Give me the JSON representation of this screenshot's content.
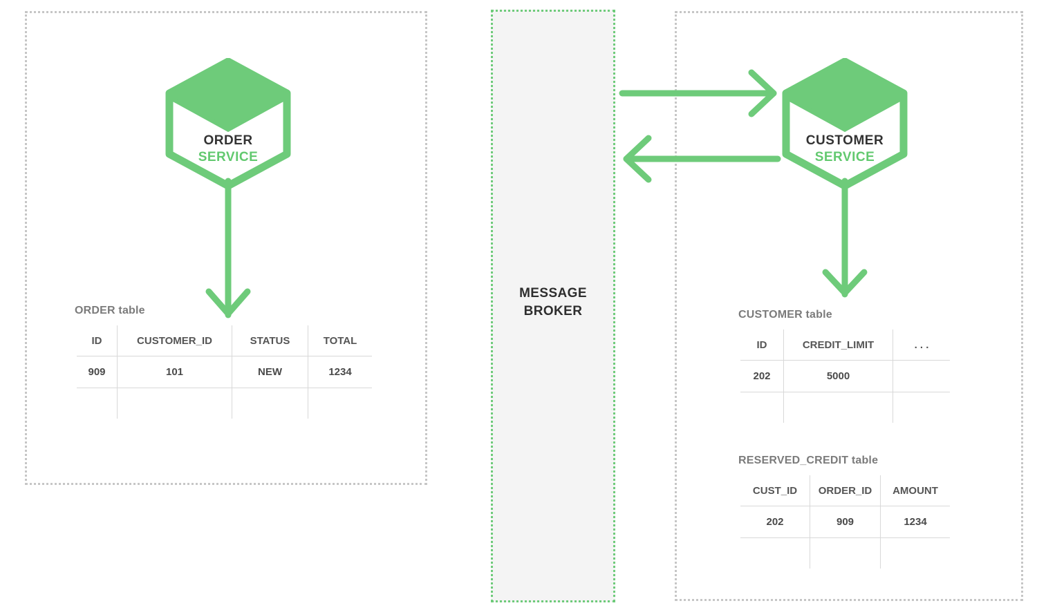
{
  "diagram": {
    "title": "Microservices saga: order service and customer service with message broker",
    "accent_green": "#6ecb7a",
    "boundary_gray": "#c6c6c6",
    "broker_fill": "#f4f4f4",
    "table_border": "#6e6e6e",
    "label_gray": "#7b7b7b"
  },
  "broker": {
    "name": "message-broker",
    "line1": "MESSAGE",
    "line2": "BROKER"
  },
  "services": [
    {
      "id": "order-service",
      "line1": "ORDER",
      "line2": "SERVICE",
      "icon": "hexagon-service-icon"
    },
    {
      "id": "customer-service",
      "line1": "CUSTOMER",
      "line2": "SERVICE",
      "icon": "hexagon-service-icon"
    }
  ],
  "arrows": [
    {
      "id": "order-service-to-order-table",
      "direction": "down",
      "icon": "arrow-down-icon"
    },
    {
      "id": "broker-to-customer-service",
      "direction": "right",
      "icon": "arrow-right-icon"
    },
    {
      "id": "customer-service-to-broker",
      "direction": "left",
      "icon": "arrow-left-icon"
    },
    {
      "id": "customer-service-to-customer-table",
      "direction": "down",
      "icon": "arrow-down-icon"
    }
  ],
  "tables": {
    "order": {
      "title": "ORDER table",
      "columns": [
        "ID",
        "CUSTOMER_ID",
        "STATUS",
        "TOTAL"
      ],
      "rows": [
        [
          "909",
          "101",
          "NEW",
          "1234"
        ],
        [
          "",
          "",
          "",
          ""
        ]
      ]
    },
    "customer": {
      "title": "CUSTOMER table",
      "columns": [
        "ID",
        "CREDIT_LIMIT",
        ". . ."
      ],
      "rows": [
        [
          "202",
          "5000",
          ""
        ],
        [
          "",
          "",
          ""
        ]
      ]
    },
    "reserved_credit": {
      "title": "RESERVED_CREDIT table",
      "columns": [
        "CUST_ID",
        "ORDER_ID",
        "AMOUNT"
      ],
      "rows": [
        [
          "202",
          "909",
          "1234"
        ],
        [
          "",
          "",
          ""
        ]
      ]
    }
  }
}
